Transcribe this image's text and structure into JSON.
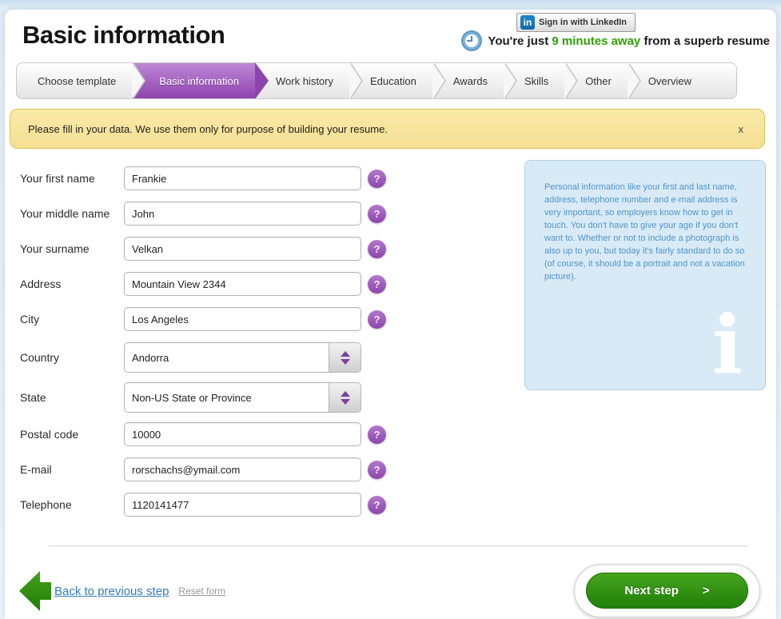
{
  "page": {
    "title": "Basic information"
  },
  "header": {
    "linkedin_label": "Sign in with LinkedIn",
    "tagline_prefix": "You're just ",
    "tagline_highlight": "9 minutes away",
    "tagline_suffix": " from a superb resume"
  },
  "steps": [
    {
      "label": "Choose template"
    },
    {
      "label": "Basic information",
      "active": true
    },
    {
      "label": "Work history"
    },
    {
      "label": "Education"
    },
    {
      "label": "Awards"
    },
    {
      "label": "Skills"
    },
    {
      "label": "Other"
    },
    {
      "label": "Overview"
    }
  ],
  "notice": {
    "text": "Please fill in your data. We use them only for purpose of building your resume.",
    "close": "x"
  },
  "form": {
    "fields": [
      {
        "label": "Your first name",
        "value": "Frankie",
        "type": "text"
      },
      {
        "label": "Your middle name",
        "value": "John",
        "type": "text"
      },
      {
        "label": "Your surname",
        "value": "Velkan",
        "type": "text"
      },
      {
        "label": "Address",
        "value": "Mountain View 2344",
        "type": "text"
      },
      {
        "label": "City",
        "value": "Los Angeles",
        "type": "text"
      },
      {
        "label": "Country",
        "value": "Andorra",
        "type": "select"
      },
      {
        "label": "State",
        "value": "Non-US State or Province",
        "type": "select"
      },
      {
        "label": "Postal code",
        "value": "10000",
        "type": "text"
      },
      {
        "label": "E-mail",
        "value": "rorschachs@ymail.com",
        "type": "text"
      },
      {
        "label": "Telephone",
        "value": "1120141477",
        "type": "text"
      }
    ]
  },
  "info_box": {
    "text": "Personal information like your first and last name, address, telephone number and e-mail address is very important, so employers know how to get in touch. You don't have to give your age if you don't want to. Whether or not to include a photograph is also up to you, but today it's fairly standard to do so (of course, it should be a portrait and not a vacation picture).",
    "glyph": "i"
  },
  "footer": {
    "back_label": "Back to previous step",
    "reset_label": "Reset form",
    "next_label": "Next step",
    "next_arrow": ">"
  },
  "icons": {
    "linkedin": "in",
    "help": "?"
  },
  "colors": {
    "accent_purple": "#8e44ad",
    "green_highlight": "#2fa005",
    "green_button": "#2f9410",
    "link_blue": "#2f7cc0",
    "notice_bg": "#f7e49e",
    "info_bg": "#d9eaf7",
    "info_text": "#4f94ca",
    "linkedin_blue": "#0e6ba8"
  }
}
